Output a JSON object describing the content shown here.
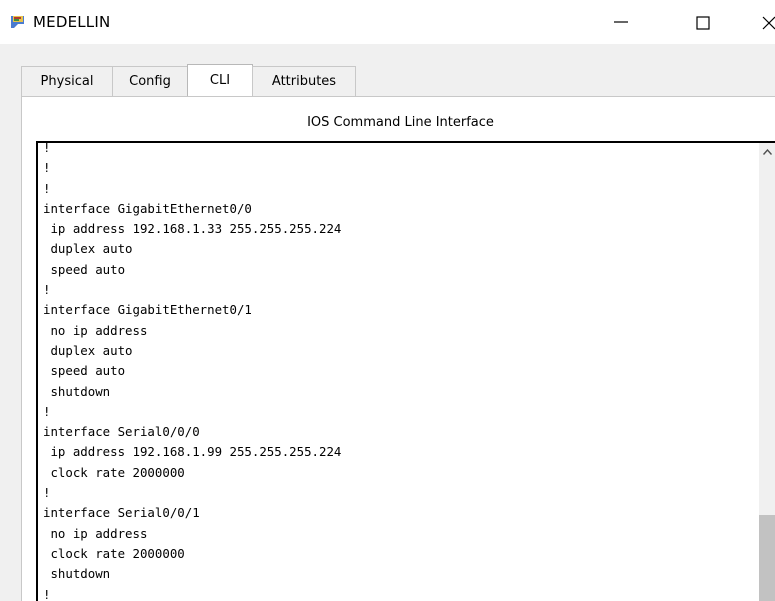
{
  "window": {
    "title": "MEDELLIN",
    "icon": "router-icon"
  },
  "tabs": [
    {
      "label": "Physical",
      "active": false
    },
    {
      "label": "Config",
      "active": false
    },
    {
      "label": "CLI",
      "active": true
    },
    {
      "label": "Attributes",
      "active": false
    }
  ],
  "cli": {
    "header": "IOS Command Line Interface",
    "lines": [
      "!",
      "!",
      "!",
      "interface GigabitEthernet0/0",
      " ip address 192.168.1.33 255.255.255.224",
      " duplex auto",
      " speed auto",
      "!",
      "interface GigabitEthernet0/1",
      " no ip address",
      " duplex auto",
      " speed auto",
      " shutdown",
      "!",
      "interface Serial0/0/0",
      " ip address 192.168.1.99 255.255.255.224",
      " clock rate 2000000",
      "!",
      "interface Serial0/0/1",
      " no ip address",
      " clock rate 2000000",
      " shutdown",
      "!"
    ]
  }
}
